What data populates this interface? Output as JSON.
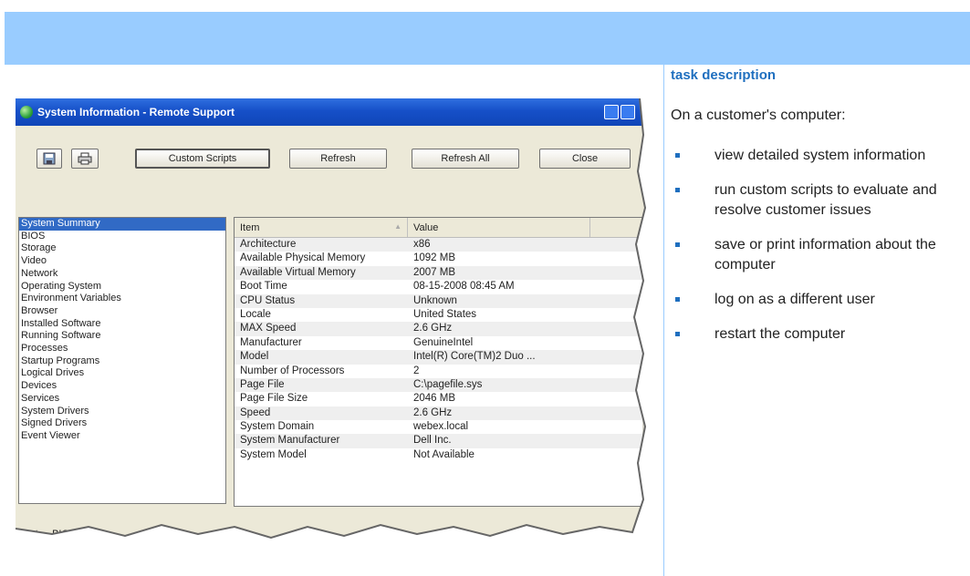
{
  "task": {
    "title": "task description",
    "intro": "On a customer's computer:",
    "items": [
      "view detailed system information",
      "run custom scripts to evaluate and resolve customer issues",
      "save or print information about the computer",
      "log on as a different user",
      "restart the computer"
    ]
  },
  "window": {
    "title": "System Information - Remote Support",
    "toolbar": {
      "save_icon": "save-icon",
      "print_icon": "printer-icon",
      "custom_scripts": "Custom Scripts",
      "refresh": "Refresh",
      "refresh_all": "Refresh All",
      "close": "Close"
    },
    "categories": [
      "System Summary",
      "BIOS",
      "Storage",
      "Video",
      "Network",
      "Operating System",
      "Environment Variables",
      "Browser",
      "Installed Software",
      "Running Software",
      "Processes",
      "Startup Programs",
      "Logical Drives",
      "Devices",
      "Services",
      "System Drivers",
      "Signed Drivers",
      "Event Viewer"
    ],
    "selected_category": "System Summary",
    "columns": {
      "item": "Item",
      "value": "Value"
    },
    "rows": [
      {
        "item": "Architecture",
        "value": "x86"
      },
      {
        "item": "Available Physical Memory",
        "value": "1092 MB"
      },
      {
        "item": "Available Virtual Memory",
        "value": "2007 MB"
      },
      {
        "item": "Boot Time",
        "value": "08-15-2008 08:45 AM"
      },
      {
        "item": "CPU Status",
        "value": "Unknown"
      },
      {
        "item": "Locale",
        "value": "United States"
      },
      {
        "item": "MAX Speed",
        "value": "2.6 GHz"
      },
      {
        "item": "Manufacturer",
        "value": "GenuineIntel"
      },
      {
        "item": "Model",
        "value": "Intel(R) Core(TM)2 Duo ..."
      },
      {
        "item": "Number of Processors",
        "value": "2"
      },
      {
        "item": "Page File",
        "value": "C:\\pagefile.sys"
      },
      {
        "item": "Page File Size",
        "value": "2046 MB"
      },
      {
        "item": "Speed",
        "value": "2.6 GHz"
      },
      {
        "item": "System Domain",
        "value": "webex.local"
      },
      {
        "item": "System Manufacturer",
        "value": "Dell Inc."
      },
      {
        "item": "System Model",
        "value": "Not Available"
      }
    ],
    "status": "Last ... BIOS Conf ..."
  },
  "colors": {
    "banner": "#99ccff",
    "accent": "#1f6fbf",
    "selection": "#316ac5"
  }
}
